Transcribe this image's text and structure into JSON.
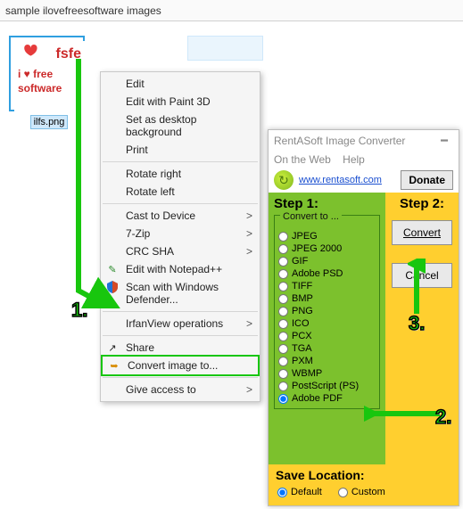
{
  "explorer": {
    "title": "sample ilovefreesoftware images",
    "file_caption": "ilfs.png",
    "thumb_line1": "fsfe",
    "thumb_line2": "i ♥ free",
    "thumb_line3": "software"
  },
  "context_menu": {
    "edit": "Edit",
    "edit_paint3d": "Edit with Paint 3D",
    "set_bg": "Set as desktop background",
    "print": "Print",
    "rotate_right": "Rotate right",
    "rotate_left": "Rotate left",
    "cast": "Cast to Device",
    "sevenzip": "7-Zip",
    "crc": "CRC SHA",
    "notepadpp": "Edit with Notepad++",
    "defender": "Scan with Windows Defender...",
    "irfan": "IrfanView operations",
    "share": "Share",
    "convert": "Convert image to...",
    "give_access": "Give access to",
    "submenu_glyph": ">"
  },
  "converter": {
    "title": "RentASoft Image Converter",
    "menu_web": "On the Web",
    "menu_help": "Help",
    "link": "www.rentasoft.com",
    "donate": "Donate",
    "step1": "Step 1:",
    "step2": "Step 2:",
    "legend": "Convert to ...",
    "formats": [
      "JPEG",
      "JPEG 2000",
      "GIF",
      "Adobe PSD",
      "TIFF",
      "BMP",
      "PNG",
      "ICO",
      "PCX",
      "TGA",
      "PXM",
      "WBMP",
      "PostScript (PS)",
      "Adobe PDF"
    ],
    "selected_format_index": 13,
    "btn_convert": "Convert",
    "btn_cancel": "Cancel",
    "save_title": "Save Location:",
    "save_default": "Default",
    "save_custom": "Custom",
    "save_selected": "default"
  },
  "annotations": {
    "n1": "1.",
    "n2": "2.",
    "n3": "3."
  }
}
